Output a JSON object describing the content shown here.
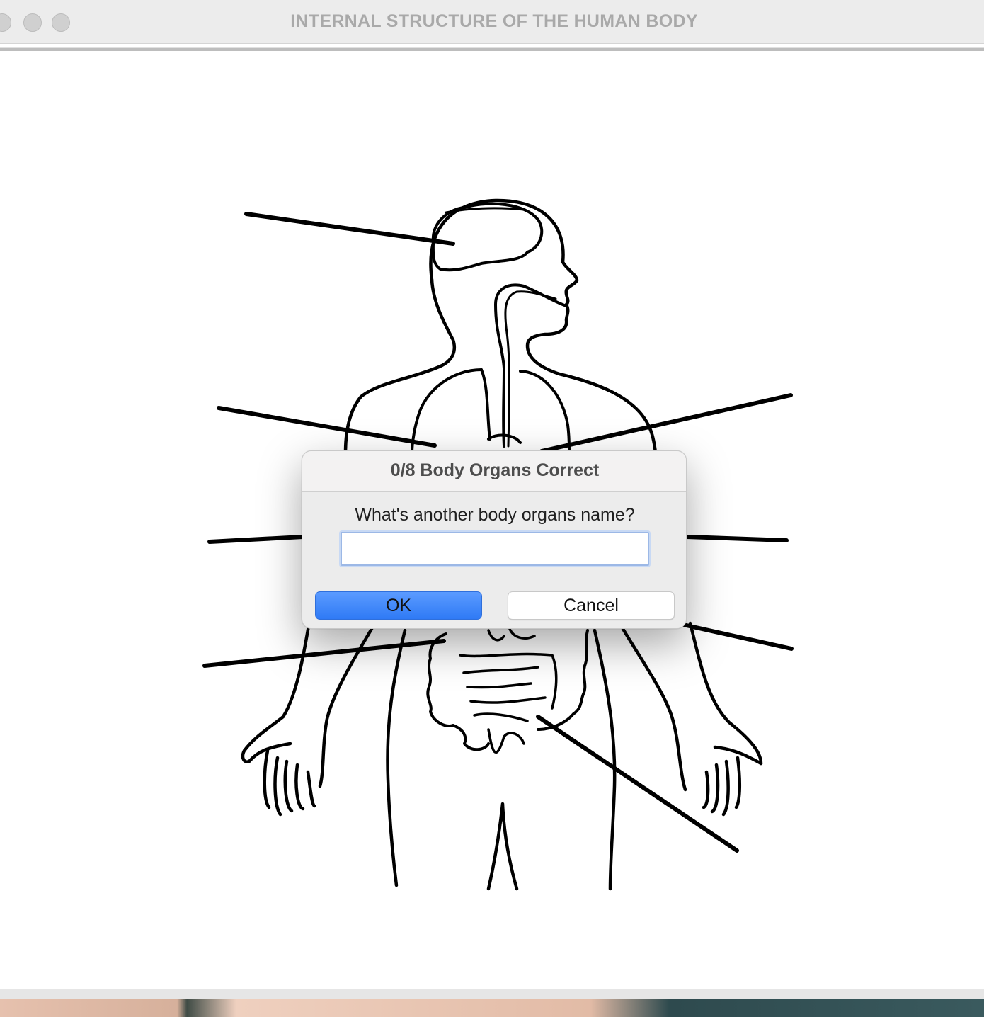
{
  "window": {
    "title": "INTERNAL STRUCTURE OF THE HUMAN BODY"
  },
  "diagram": {
    "subject": "human-body-internal-organs",
    "label_line_count": 8,
    "labels_filled": []
  },
  "dialog": {
    "title": "0/8 Body Organs Correct",
    "prompt": "What's another body organs name?",
    "input_value": "",
    "input_placeholder": "",
    "ok_label": "OK",
    "cancel_label": "Cancel"
  },
  "colors": {
    "accent": "#2f7af5",
    "title_text": "#a9a9a9",
    "ink": "#000000"
  }
}
